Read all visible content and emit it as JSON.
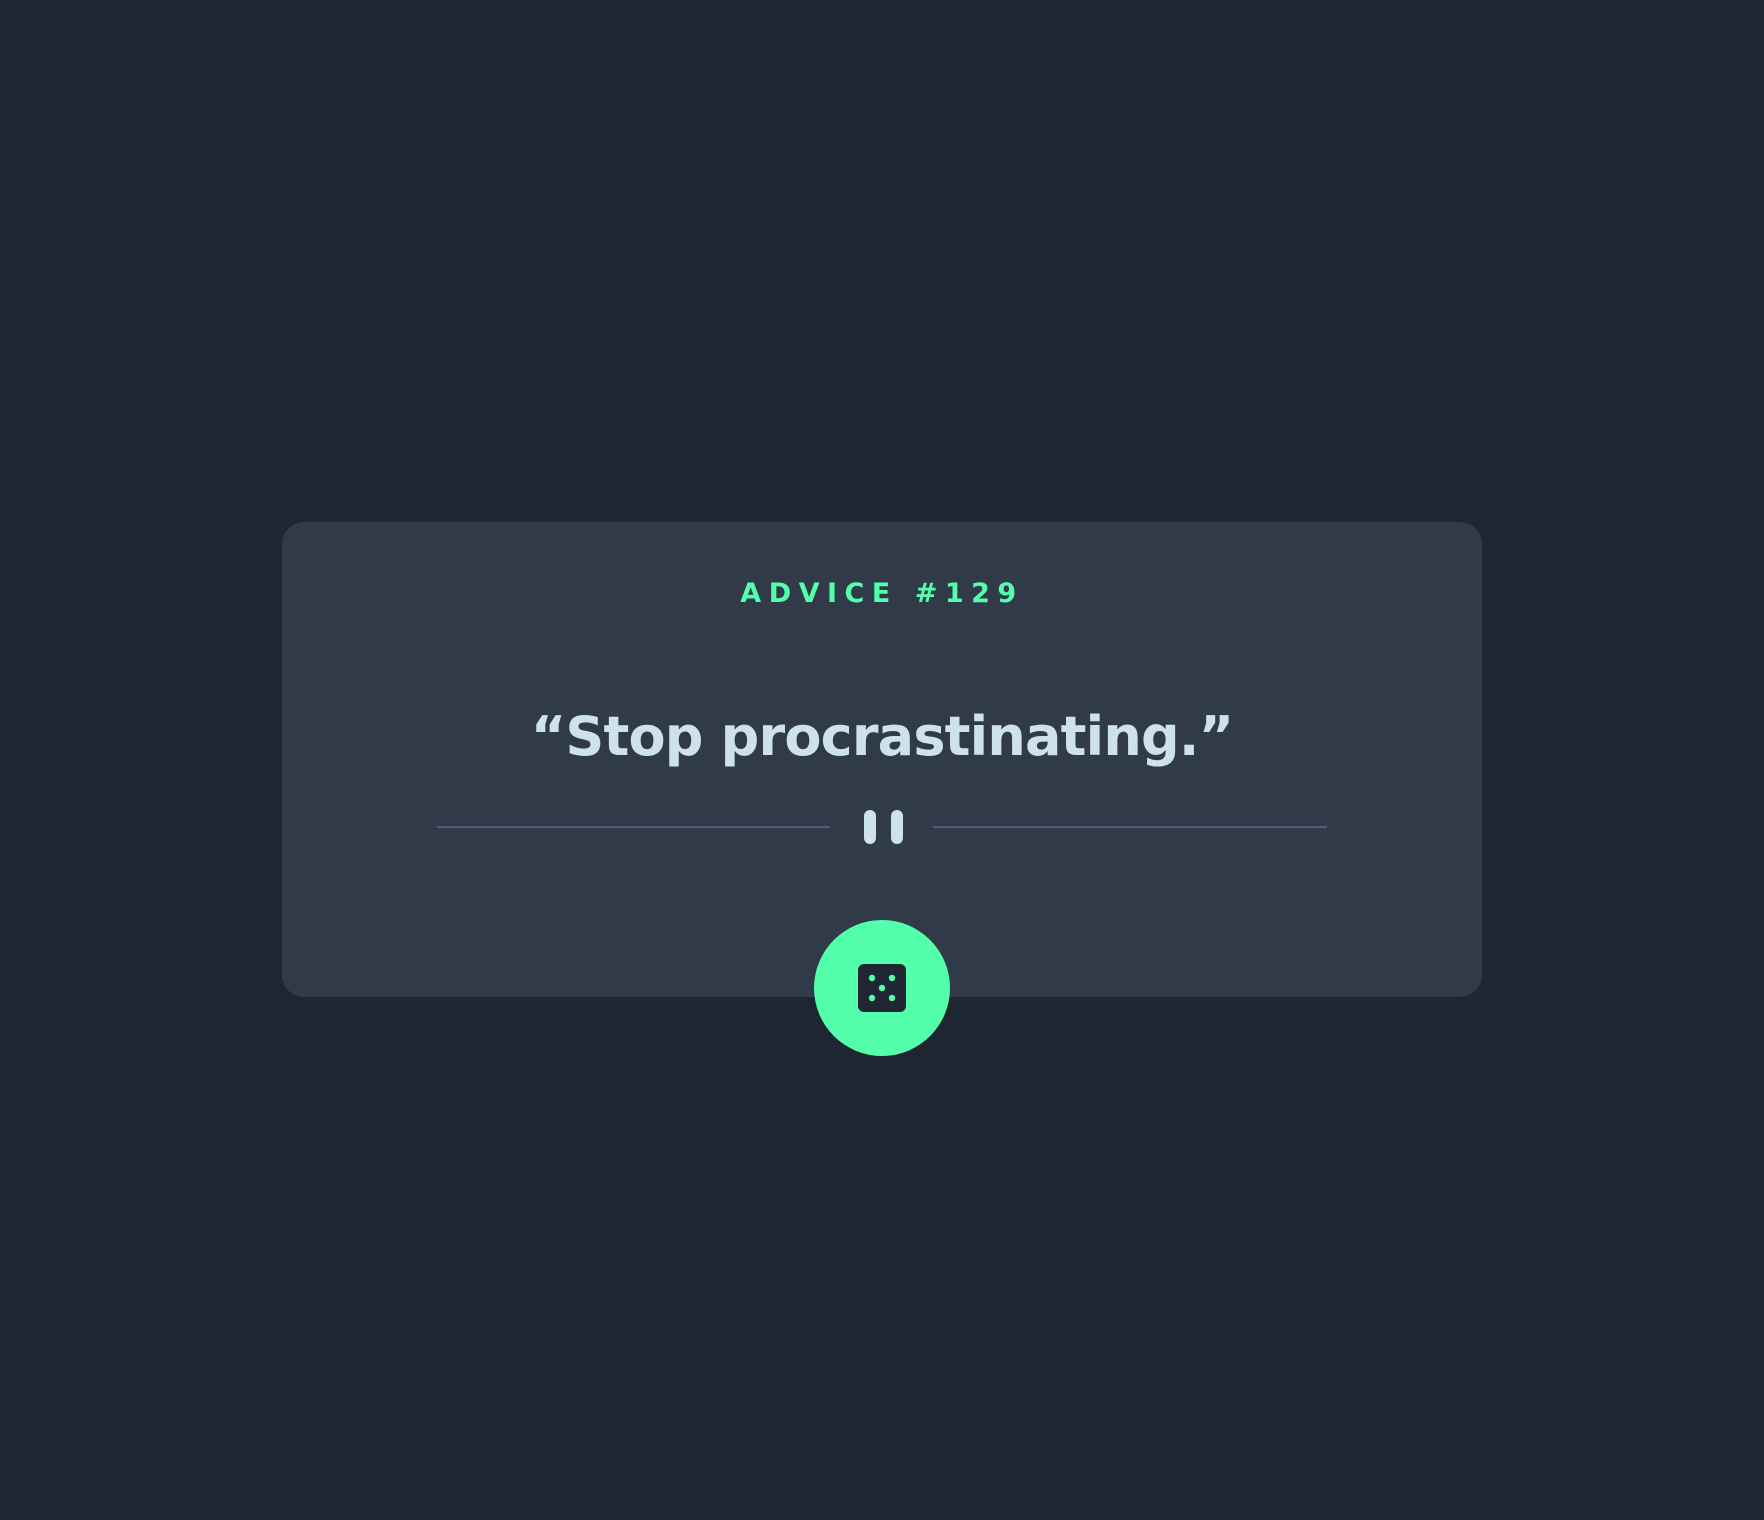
{
  "advice": {
    "label": "ADVICE #129",
    "quote": "“Stop procrastinating.”"
  },
  "divider": {
    "icon": "pause-icon"
  },
  "button": {
    "icon": "dice-icon"
  },
  "colors": {
    "background": "#1F2632",
    "card": "#313A49",
    "accent": "#53FFAA",
    "text": "#CEE3E9",
    "divider": "#4F5D74"
  }
}
